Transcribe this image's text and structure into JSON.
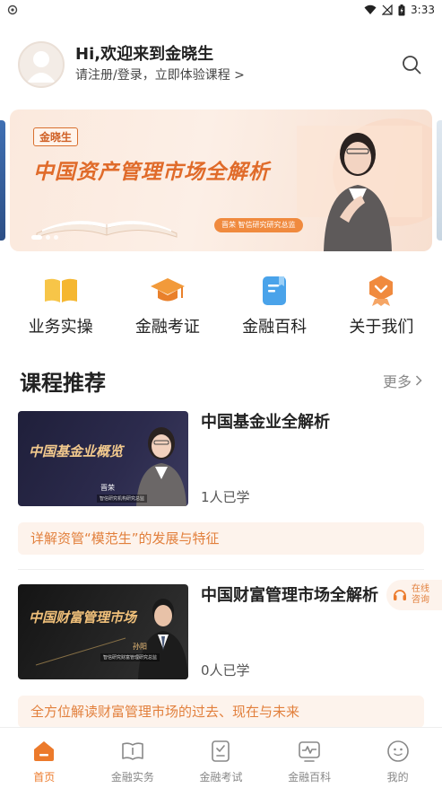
{
  "status_bar": {
    "time": "3:33"
  },
  "header": {
    "greeting": "Hi,欢迎来到金晓生",
    "subtitle": "请注册/登录，立即体验课程 >"
  },
  "banner": {
    "logo": "金晓生",
    "title": "中国资产管理市场全解析",
    "tag": "晋荣  智信研究研究总监",
    "slide_count": 3,
    "active_slide": 1
  },
  "quick_menu": [
    {
      "label": "业务实操",
      "icon": "book-icon"
    },
    {
      "label": "金融考证",
      "icon": "graduation-cap-icon"
    },
    {
      "label": "金融百科",
      "icon": "encyclopedia-icon"
    },
    {
      "label": "关于我们",
      "icon": "badge-icon"
    }
  ],
  "section": {
    "title": "课程推荐",
    "more": "更多"
  },
  "courses": [
    {
      "thumb_title": "中国基金业概览",
      "thumb_name": "晋荣",
      "thumb_caption": "智信研究机构研究总监",
      "title": "中国基金业全解析",
      "learners": "1人已学",
      "description": "详解资管“模范生”的发展与特征"
    },
    {
      "thumb_title": "中国财富管理市场",
      "thumb_name": "孙阳",
      "thumb_caption": "智信研究财富管理研究总监",
      "title": "中国财富管理市场全解析",
      "learners": "0人已学",
      "description": "全方位解读财富管理市场的过去、现在与未来"
    }
  ],
  "consult": {
    "line1": "在线",
    "line2": "咨询"
  },
  "tabbar": [
    {
      "label": "首页",
      "icon": "home-icon",
      "active": true
    },
    {
      "label": "金融实务",
      "icon": "open-book-icon",
      "active": false
    },
    {
      "label": "金融考试",
      "icon": "exam-checklist-icon",
      "active": false
    },
    {
      "label": "金融百科",
      "icon": "chart-monitor-icon",
      "active": false
    },
    {
      "label": "我的",
      "icon": "profile-face-icon",
      "active": false
    }
  ],
  "colors": {
    "accent": "#ec7a2b",
    "accent_light": "#fdf3ec",
    "text": "#222222",
    "muted": "#888888"
  }
}
